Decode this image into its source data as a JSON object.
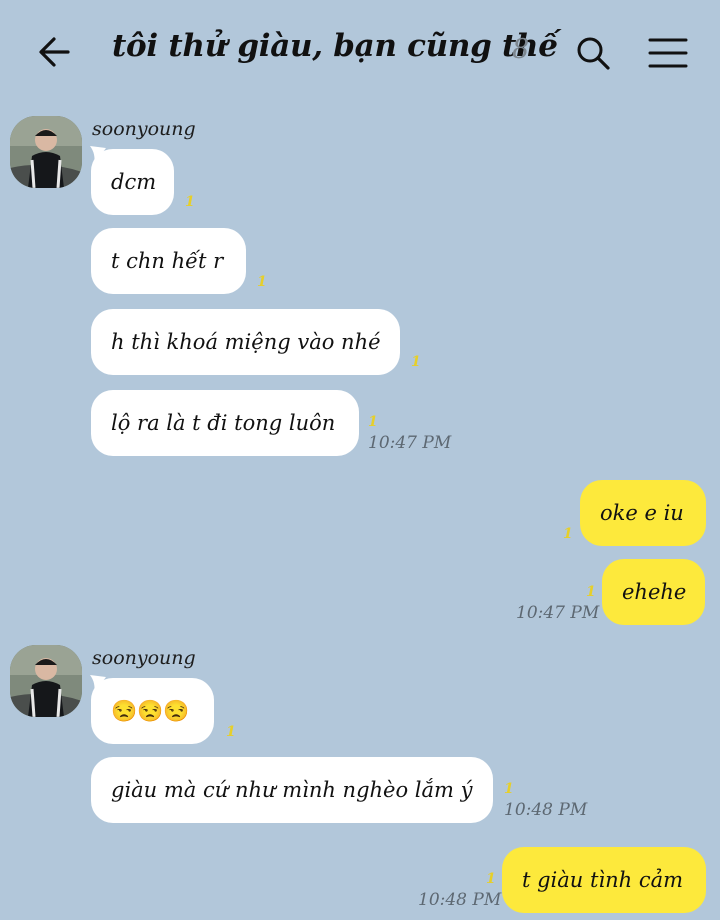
{
  "header": {
    "title": "tôi thử giàu, bạn cũng thế",
    "member_count": "8"
  },
  "messages": [
    {
      "sender": "soonyoung"
    },
    {
      "text": "dcm",
      "unread": "1"
    },
    {
      "text": "t chn hết r",
      "unread": "1"
    },
    {
      "text": "h thì khoá miệng vào nhé",
      "unread": "1"
    },
    {
      "text": "lộ ra là t đi tong luôn",
      "unread": "1",
      "time": "10:47 PM"
    },
    {
      "text": "oke e iu",
      "unread": "1"
    },
    {
      "text": "ehehe",
      "unread": "1",
      "time": "10:47 PM"
    },
    {
      "sender": "soonyoung"
    },
    {
      "text": "😒😒😒",
      "unread": "1"
    },
    {
      "text": "giàu mà cứ như mình nghèo lắm ý",
      "unread": "1",
      "time": "10:48 PM"
    },
    {
      "text": "t giàu tình cảm",
      "unread": "1",
      "time": "10:48 PM"
    }
  ],
  "icons": {
    "back": "arrow-left-icon",
    "search": "search-icon",
    "menu": "hamburger-menu-icon",
    "emoji": "unamused-face-icon"
  },
  "colors": {
    "background": "#b2c7da",
    "incoming_bubble": "#ffffff",
    "outgoing_bubble": "#fde93c",
    "unread_marker": "#e6cf2a"
  }
}
